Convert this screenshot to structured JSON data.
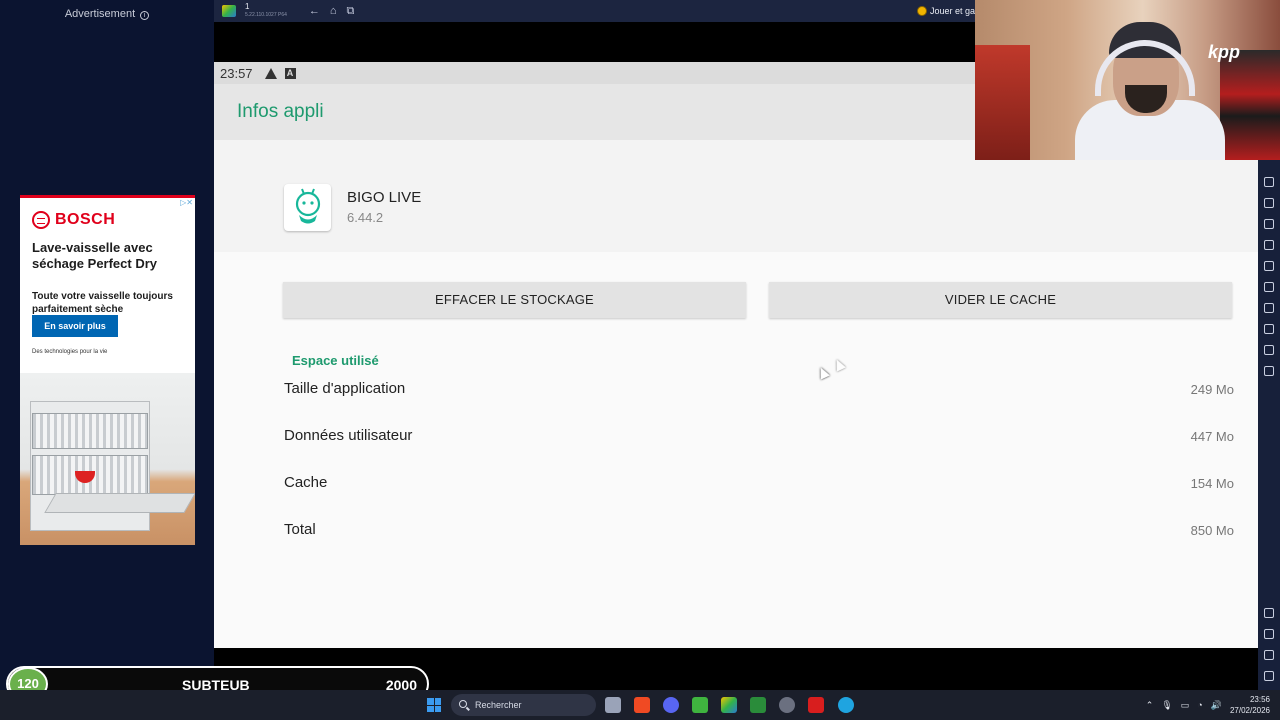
{
  "ad": {
    "label": "Advertisement",
    "brand": "BOSCH",
    "headline": "Lave-vaisselle avec séchage Perfect Dry",
    "subline": "Toute votre vaisselle toujours parfaitement sèche",
    "cta": "En savoir plus",
    "tagline": "Des technologies pour la vie"
  },
  "emulator": {
    "instance_name": "1",
    "instance_sub": "5.22.110.1027 P64",
    "right_text": "Jouer et ga"
  },
  "android": {
    "status_time": "23:57",
    "appbar_title": "Infos appli",
    "app_name": "BIGO LIVE",
    "app_version": "6.44.2",
    "clear_storage_label": "EFFACER LE STOCKAGE",
    "clear_cache_label": "VIDER LE CACHE",
    "section_title": "Espace utilisé",
    "storage_rows": [
      {
        "label": "Taille d'application",
        "value": "249 Mo"
      },
      {
        "label": "Données utilisateur",
        "value": "447 Mo"
      },
      {
        "label": "Cache",
        "value": "154 Mo"
      },
      {
        "label": "Total",
        "value": "850 Mo"
      }
    ]
  },
  "webcam": {
    "jersey_text": "kpp"
  },
  "sub_goal": {
    "current": "120",
    "label": "SUBTEUB",
    "target": "2000"
  },
  "taskbar": {
    "search_placeholder": "Rechercher",
    "clock_time": "23:56",
    "clock_date": "27/02/2026"
  },
  "colors": {
    "accent_green": "#1e9a6e",
    "bosch_red": "#e0001b",
    "bosch_blue": "#0066b3"
  }
}
